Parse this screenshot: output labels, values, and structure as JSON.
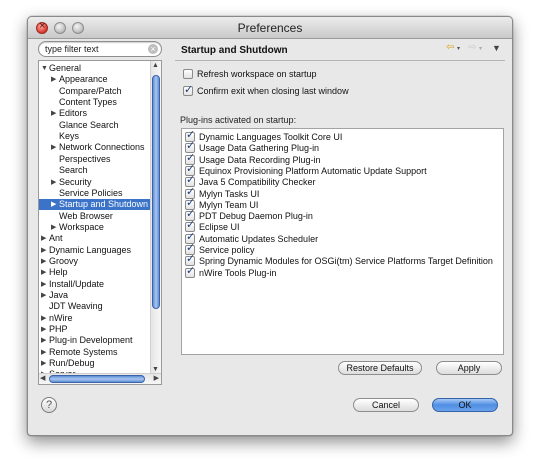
{
  "window": {
    "title": "Preferences"
  },
  "filter": {
    "placeholder": "type filter text"
  },
  "tree": [
    {
      "label": "General",
      "twisty": "▼",
      "indent": 0
    },
    {
      "label": "Appearance",
      "twisty": "▶",
      "indent": 1
    },
    {
      "label": "Compare/Patch",
      "twisty": "",
      "indent": 1
    },
    {
      "label": "Content Types",
      "twisty": "",
      "indent": 1
    },
    {
      "label": "Editors",
      "twisty": "▶",
      "indent": 1
    },
    {
      "label": "Glance Search",
      "twisty": "",
      "indent": 1
    },
    {
      "label": "Keys",
      "twisty": "",
      "indent": 1
    },
    {
      "label": "Network Connections",
      "twisty": "▶",
      "indent": 1
    },
    {
      "label": "Perspectives",
      "twisty": "",
      "indent": 1
    },
    {
      "label": "Search",
      "twisty": "",
      "indent": 1
    },
    {
      "label": "Security",
      "twisty": "▶",
      "indent": 1
    },
    {
      "label": "Service Policies",
      "twisty": "",
      "indent": 1
    },
    {
      "label": "Startup and Shutdown",
      "twisty": "▶",
      "indent": 1,
      "selected": true
    },
    {
      "label": "Web Browser",
      "twisty": "",
      "indent": 1
    },
    {
      "label": "Workspace",
      "twisty": "▶",
      "indent": 1
    },
    {
      "label": "Ant",
      "twisty": "▶",
      "indent": 0
    },
    {
      "label": "Dynamic Languages",
      "twisty": "▶",
      "indent": 0
    },
    {
      "label": "Groovy",
      "twisty": "▶",
      "indent": 0
    },
    {
      "label": "Help",
      "twisty": "▶",
      "indent": 0
    },
    {
      "label": "Install/Update",
      "twisty": "▶",
      "indent": 0
    },
    {
      "label": "Java",
      "twisty": "▶",
      "indent": 0
    },
    {
      "label": "JDT Weaving",
      "twisty": "",
      "indent": 0
    },
    {
      "label": "nWire",
      "twisty": "▶",
      "indent": 0
    },
    {
      "label": "PHP",
      "twisty": "▶",
      "indent": 0
    },
    {
      "label": "Plug-in Development",
      "twisty": "▶",
      "indent": 0
    },
    {
      "label": "Remote Systems",
      "twisty": "▶",
      "indent": 0
    },
    {
      "label": "Run/Debug",
      "twisty": "▶",
      "indent": 0
    },
    {
      "label": "Server",
      "twisty": "▶",
      "indent": 0
    }
  ],
  "page": {
    "title": "Startup and Shutdown",
    "refresh_label": "Refresh workspace on startup",
    "refresh_checked": false,
    "confirm_label": "Confirm exit when closing last window",
    "confirm_checked": true,
    "plugins_label": "Plug-ins activated on startup:",
    "plugins": [
      "Dynamic Languages Toolkit Core UI",
      "Usage Data Gathering Plug-in",
      "Usage Data Recording Plug-in",
      "Equinox Provisioning Platform Automatic Update Support",
      "Java 5 Compatibility Checker",
      "Mylyn Tasks UI",
      "Mylyn Team UI",
      "PDT Debug Daemon Plug-in",
      "Eclipse UI",
      "Automatic Updates Scheduler",
      "Service policy",
      "Spring Dynamic Modules for OSGi(tm) Service Platforms Target Definition",
      "nWire Tools Plug-in"
    ]
  },
  "buttons": {
    "restore_defaults": "Restore Defaults",
    "apply": "Apply",
    "cancel": "Cancel",
    "ok": "OK",
    "help": "?"
  },
  "icons": {
    "back": "back-arrow-icon",
    "forward": "forward-arrow-icon",
    "menu": "view-menu-icon"
  }
}
